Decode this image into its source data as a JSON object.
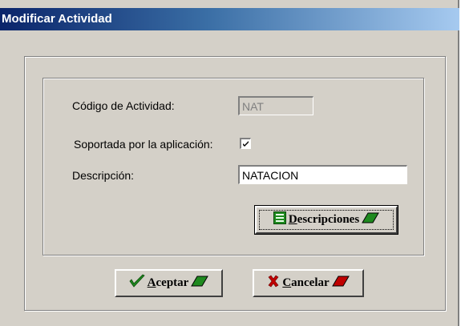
{
  "window": {
    "title": "Modificar Actividad"
  },
  "form": {
    "codigo_label": "Código de Actividad:",
    "codigo_value": "NAT",
    "soportada_label": "Soportada por la aplicación:",
    "soportada_checked": true,
    "descripcion_label": "Descripción:",
    "descripcion_value": "NATACION"
  },
  "buttons": {
    "descripciones": {
      "mnemonic": "D",
      "rest": "escripciones"
    },
    "aceptar": {
      "mnemonic": "A",
      "rest": "ceptar"
    },
    "cancelar": {
      "mnemonic": "C",
      "rest": "ancelar"
    }
  },
  "icons": {
    "descripciones": "list-icon",
    "aceptar": "checkmark-icon",
    "cancelar": "red-x-icon",
    "button_trailing_aceptar": "green-parallelogram-icon",
    "button_trailing_descripciones": "green-parallelogram-icon",
    "button_trailing_cancelar": "red-parallelogram-icon"
  },
  "colors": {
    "titlebar_start": "#0a246a",
    "titlebar_end": "#a6caf0",
    "face": "#d4d0c8",
    "green": "#1f8a1f",
    "red": "#c00000"
  }
}
